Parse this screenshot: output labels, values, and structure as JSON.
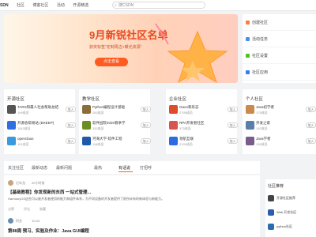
{
  "topbar": {
    "logo": "SDN",
    "nav": [
      "社区",
      "博客社区",
      "活动",
      "开源精选"
    ],
    "search_placeholder": "搜CSDN"
  },
  "banner": {
    "title": "9月新锐社区名单",
    "subtitle": "获奖标签“定制周边+曝光资源”",
    "button": "点击查看",
    "colors": {
      "accent": "#ff5a1f",
      "title": "#e84a1f"
    }
  },
  "right_rail": {
    "items": [
      {
        "label": "创建社区",
        "icon_color": "#ff7a45"
      },
      {
        "label": "活动任务",
        "icon_color": "#4a90e2"
      },
      {
        "label": "社区设置",
        "icon_color": "#52c41a"
      },
      {
        "label": "社区应用",
        "icon_color": "#2f80ed"
      }
    ]
  },
  "communities": [
    {
      "title": "开源社区",
      "items": [
        {
          "name": "TARS和最人社会帮助总结",
          "count": "199成员",
          "join": "加入",
          "color": "#555"
        },
        {
          "name": "开源会帮易站 (BXEEP)",
          "count": "1163成员",
          "join": "加入",
          "color": "#2f6fe0"
        },
        {
          "name": "openclaus",
          "count": "101成员",
          "join": "加入",
          "color": "#3a9bdc"
        }
      ]
    },
    {
      "title": "教学社区",
      "items": [
        {
          "name": "Python编程设计基础",
          "count": "283成员",
          "join": "加入",
          "color": "#8a6d3b"
        },
        {
          "name": "软件园院2020春季学",
          "count": "152成员",
          "join": "加入",
          "color": "#6b8e23"
        },
        {
          "name": "河海大学-软件工程",
          "count": "118成员",
          "join": "加入",
          "color": "#1e5aa8"
        }
      ]
    },
    {
      "title": "企业社区",
      "items": [
        {
          "name": "Gaoo和形态",
          "count": "2795成员",
          "join": "加入",
          "color": "#e04b2b"
        },
        {
          "name": "RPA开发者社区",
          "count": "373成员",
          "join": "加入",
          "color": "#d9534f"
        },
        {
          "name": "领航互联",
          "count": "2120成员",
          "join": "加入",
          "color": "#2d6cdf"
        }
      ]
    },
    {
      "title": "个人社区",
      "items": [
        {
          "name": "Java初学者",
          "count": "175成员",
          "join": "加入",
          "color": "#c98a4b"
        },
        {
          "name": "开发之家",
          "count": "192成员",
          "join": "加入",
          "color": "#5a7fa8"
        },
        {
          "name": "Java学者",
          "count": "155成员",
          "join": "加入",
          "color": "#7a5c8a"
        }
      ]
    }
  ],
  "tabs": [
    "关注社区",
    "最新动态",
    "最新问题",
    "最热",
    "有话说",
    "打招呼"
  ],
  "active_tab": "有话说",
  "posts": [
    {
      "author": "记年龙",
      "time": "20小时前",
      "title": "【基础教程】你发现新的东西 一站式管理...",
      "body": "HarmonyOS这些可以被开发者使用的能力和组件体系，为不同设备的开发者提供了前所未有的新体验与新能力。",
      "actions": [
        "点赞",
        "评论",
        "收藏"
      ],
      "avatar_color": "#c9a27e"
    },
    {
      "author": "阿金",
      "time": "10-04",
      "title": "第88周 预习、实验及作业：Java GUI编程",
      "body": "",
      "actions": [],
      "avatar_color": "#6a8caf"
    }
  ],
  "side_panel": {
    "title": "社区推荐",
    "items": [
      {
        "label": "开源社区推荐",
        "color": "#444"
      },
      {
        "label": "Web 开发社区",
        "color": "#2a5db0"
      },
      {
        "label": "python社区",
        "color": "#2b6cb0"
      }
    ]
  }
}
